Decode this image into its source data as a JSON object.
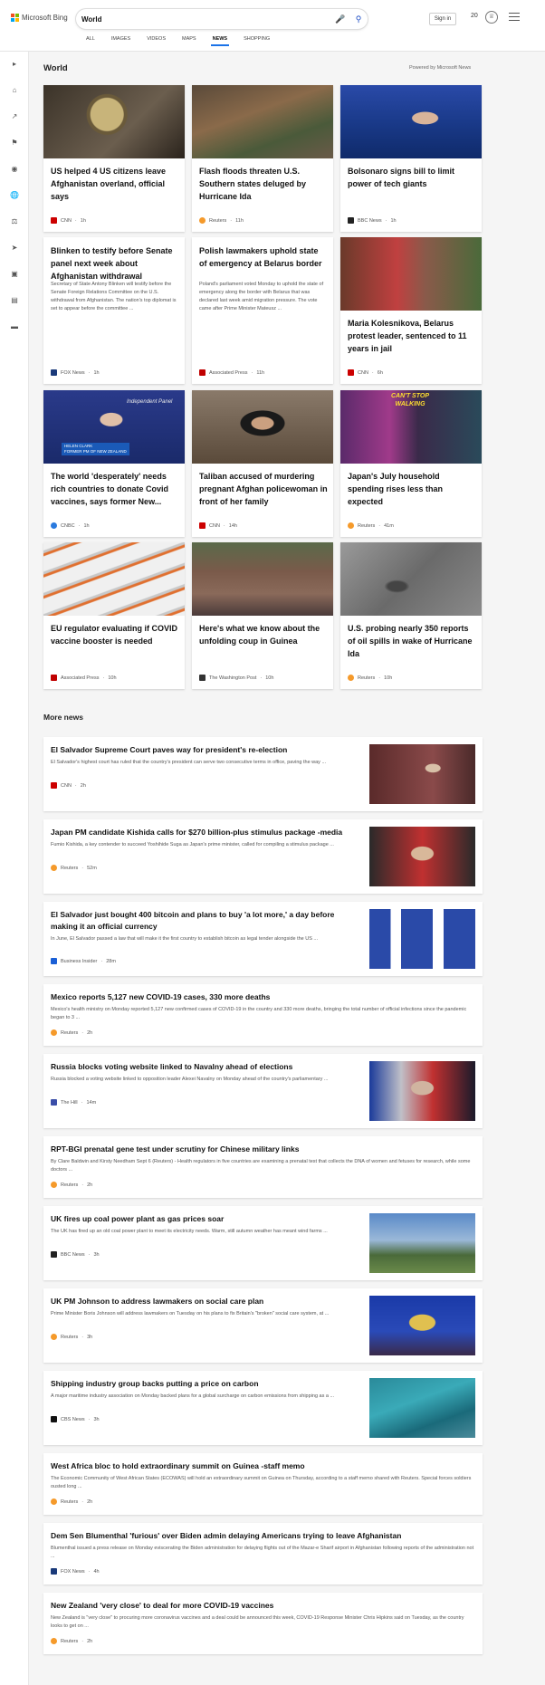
{
  "header": {
    "brand": "Microsoft Bing",
    "search_value": "World",
    "signin": "Sign in",
    "rewards_count": "20",
    "tabs": [
      "ALL",
      "IMAGES",
      "VIDEOS",
      "MAPS",
      "NEWS",
      "SHOPPING"
    ],
    "active_tab": "NEWS"
  },
  "section": {
    "title": "World",
    "powered_by": "Powered by Microsoft News"
  },
  "cards": [
    {
      "title": "US helped 4 US citizens leave Afghanistan overland, official says",
      "desc": "",
      "source": "CNN",
      "time": "1h",
      "fav": "#cc0000"
    },
    {
      "title": "Flash floods threaten U.S. Southern states deluged by Hurricane Ida",
      "desc": "",
      "source": "Reuters",
      "time": "11h",
      "fav": "#f59a2b"
    },
    {
      "title": "Bolsonaro signs bill to limit power of tech giants",
      "desc": "",
      "source": "BBC News",
      "time": "1h",
      "fav": "#222222"
    },
    {
      "title": "Blinken to testify before Senate panel next week about Afghanistan withdrawal",
      "desc": "Secretary of State Antony Blinken will testify before the Senate Foreign Relations Committee on the U.S. withdrawal from Afghanistan. The nation's top diplomat is set to appear before the committee ...",
      "source": "FOX News",
      "time": "1h",
      "fav": "#1a3a7a"
    },
    {
      "title": "Polish lawmakers uphold state of emergency at Belarus border",
      "desc": "Poland's parliament voted Monday to uphold the state of emergency along the border with Belarus that was declared last week amid migration pressure. The vote came after Prime Minister Mateusz ...",
      "source": "Associated Press",
      "time": "11h",
      "fav": "#c00000"
    },
    {
      "title": "Maria Kolesnikova, Belarus protest leader, sentenced to 11 years in jail",
      "desc": "",
      "source": "CNN",
      "time": "6h",
      "fav": "#cc0000"
    },
    {
      "title": "The world 'desperately' needs rich countries to donate Covid vaccines, says former New...",
      "desc": "",
      "source": "CNBC",
      "time": "1h",
      "fav": "#2a7ade"
    },
    {
      "title": "Taliban accused of murdering pregnant Afghan policewoman in front of her family",
      "desc": "",
      "source": "CNN",
      "time": "14h",
      "fav": "#cc0000"
    },
    {
      "title": "Japan's July household spending rises less than expected",
      "desc": "",
      "source": "Reuters",
      "time": "41m",
      "fav": "#f59a2b"
    },
    {
      "title": "EU regulator evaluating if COVID vaccine booster is needed",
      "desc": "",
      "source": "Associated Press",
      "time": "10h",
      "fav": "#c00000"
    },
    {
      "title": "Here's what we know about the unfolding coup in Guinea",
      "desc": "",
      "source": "The Washington Post",
      "time": "10h",
      "fav": "#333333"
    },
    {
      "title": "U.S. probing nearly 350 reports of oil spills in wake of Hurricane Ida",
      "desc": "",
      "source": "Reuters",
      "time": "10h",
      "fav": "#f59a2b"
    }
  ],
  "thumb_overlays": {
    "ad": "CAN'T STOP WALKING",
    "lower_third_top": "HELEN CLARK",
    "lower_third_bottom": "FORMER PM OF NEW ZEALAND",
    "panel_caption": "Independent Panel"
  },
  "more": {
    "title": "More news",
    "items": [
      {
        "title": "El Salvador Supreme Court paves way for president's re-election",
        "desc": "El Salvador's highest court has ruled that the country's president can serve two consecutive terms in office, paving the way ...",
        "source": "CNN",
        "time": "2h",
        "fav": "#cc0000"
      },
      {
        "title": "Japan PM candidate Kishida calls for $270 billion-plus stimulus package -media",
        "desc": "Fumio Kishida, a key contender to succeed Yoshihide Suga as Japan's prime minister, called for compiling a stimulus package ...",
        "source": "Reuters",
        "time": "52m",
        "fav": "#f59a2b"
      },
      {
        "title": "El Salvador just bought 400 bitcoin and plans to buy 'a lot more,' a day before making it an official currency",
        "desc": "In June, El Salvador passed a law that will make it the first country to establish bitcoin as legal tender alongside the US ...",
        "source": "Business Insider",
        "time": "28m",
        "fav": "#1a5fd6"
      },
      {
        "title": "Mexico reports 5,127 new COVID-19 cases, 330 more deaths",
        "desc": "Mexico's health ministry on Monday reported 5,127 new confirmed cases of COVID-19 in the country and 330 more deaths, bringing the total number of official infections since the pandemic began to 3 ...",
        "source": "Reuters",
        "time": "2h",
        "fav": "#f59a2b"
      },
      {
        "title": "Russia blocks voting website linked to Navalny ahead of elections",
        "desc": "Russia blocked a voting website linked to opposition leader Alexei Navalny on Monday ahead of the country's parliamentary ...",
        "source": "The Hill",
        "time": "14m",
        "fav": "#3a4ea8"
      },
      {
        "title": "RPT-BGI prenatal gene test under scrutiny for Chinese military links",
        "desc": "By Clare Baldwin and Kirsty Needham Sept 6 (Reuters) - Health regulators in five countries are examining a prenatal test that collects the DNA of women and fetuses for research, while some doctors ...",
        "source": "Reuters",
        "time": "2h",
        "fav": "#f59a2b"
      },
      {
        "title": "UK fires up coal power plant as gas prices soar",
        "desc": "The UK has fired up an old coal power plant to meet its electricity needs. Warm, still autumn weather has meant wind farms ...",
        "source": "BBC News",
        "time": "3h",
        "fav": "#222222"
      },
      {
        "title": "UK PM Johnson to address lawmakers on social care plan",
        "desc": "Prime Minister Boris Johnson will address lawmakers on Tuesday on his plans to fix Britain's \"broken\" social care system, at ...",
        "source": "Reuters",
        "time": "3h",
        "fav": "#f59a2b"
      },
      {
        "title": "Shipping industry group backs putting a price on carbon",
        "desc": "A major maritime industry association on Monday backed plans for a global surcharge on carbon emissions from shipping as a ...",
        "source": "CBS News",
        "time": "3h",
        "fav": "#111111"
      },
      {
        "title": "West Africa bloc to hold extraordinary summit on Guinea -staff memo",
        "desc": "The Economic Community of West African States (ECOWAS) will hold an extraordinary summit on Guinea on Thursday, according to a staff memo shared with Reuters. Special forces soldiers ousted long ...",
        "source": "Reuters",
        "time": "2h",
        "fav": "#f59a2b"
      },
      {
        "title": "Dem Sen Blumenthal 'furious' over Biden admin delaying Americans trying to leave Afghanistan",
        "desc": "Blumenthal issued a press release on Monday eviscerating the Biden administration for delaying flights out of the Mazar-e Sharif airport in Afghanistan following reports of the administration not ...",
        "source": "FOX News",
        "time": "4h",
        "fav": "#1a3a7a"
      },
      {
        "title": "New Zealand 'very close' to deal for more COVID-19 vaccines",
        "desc": "New Zealand is \"very close\" to procuring more coronavirus vaccines and a deal could be announced this week, COVID-19 Response Minister Chris Hipkins said on Tuesday, as the country looks to get on ...",
        "source": "Reuters",
        "time": "2h",
        "fav": "#f59a2b"
      }
    ]
  }
}
